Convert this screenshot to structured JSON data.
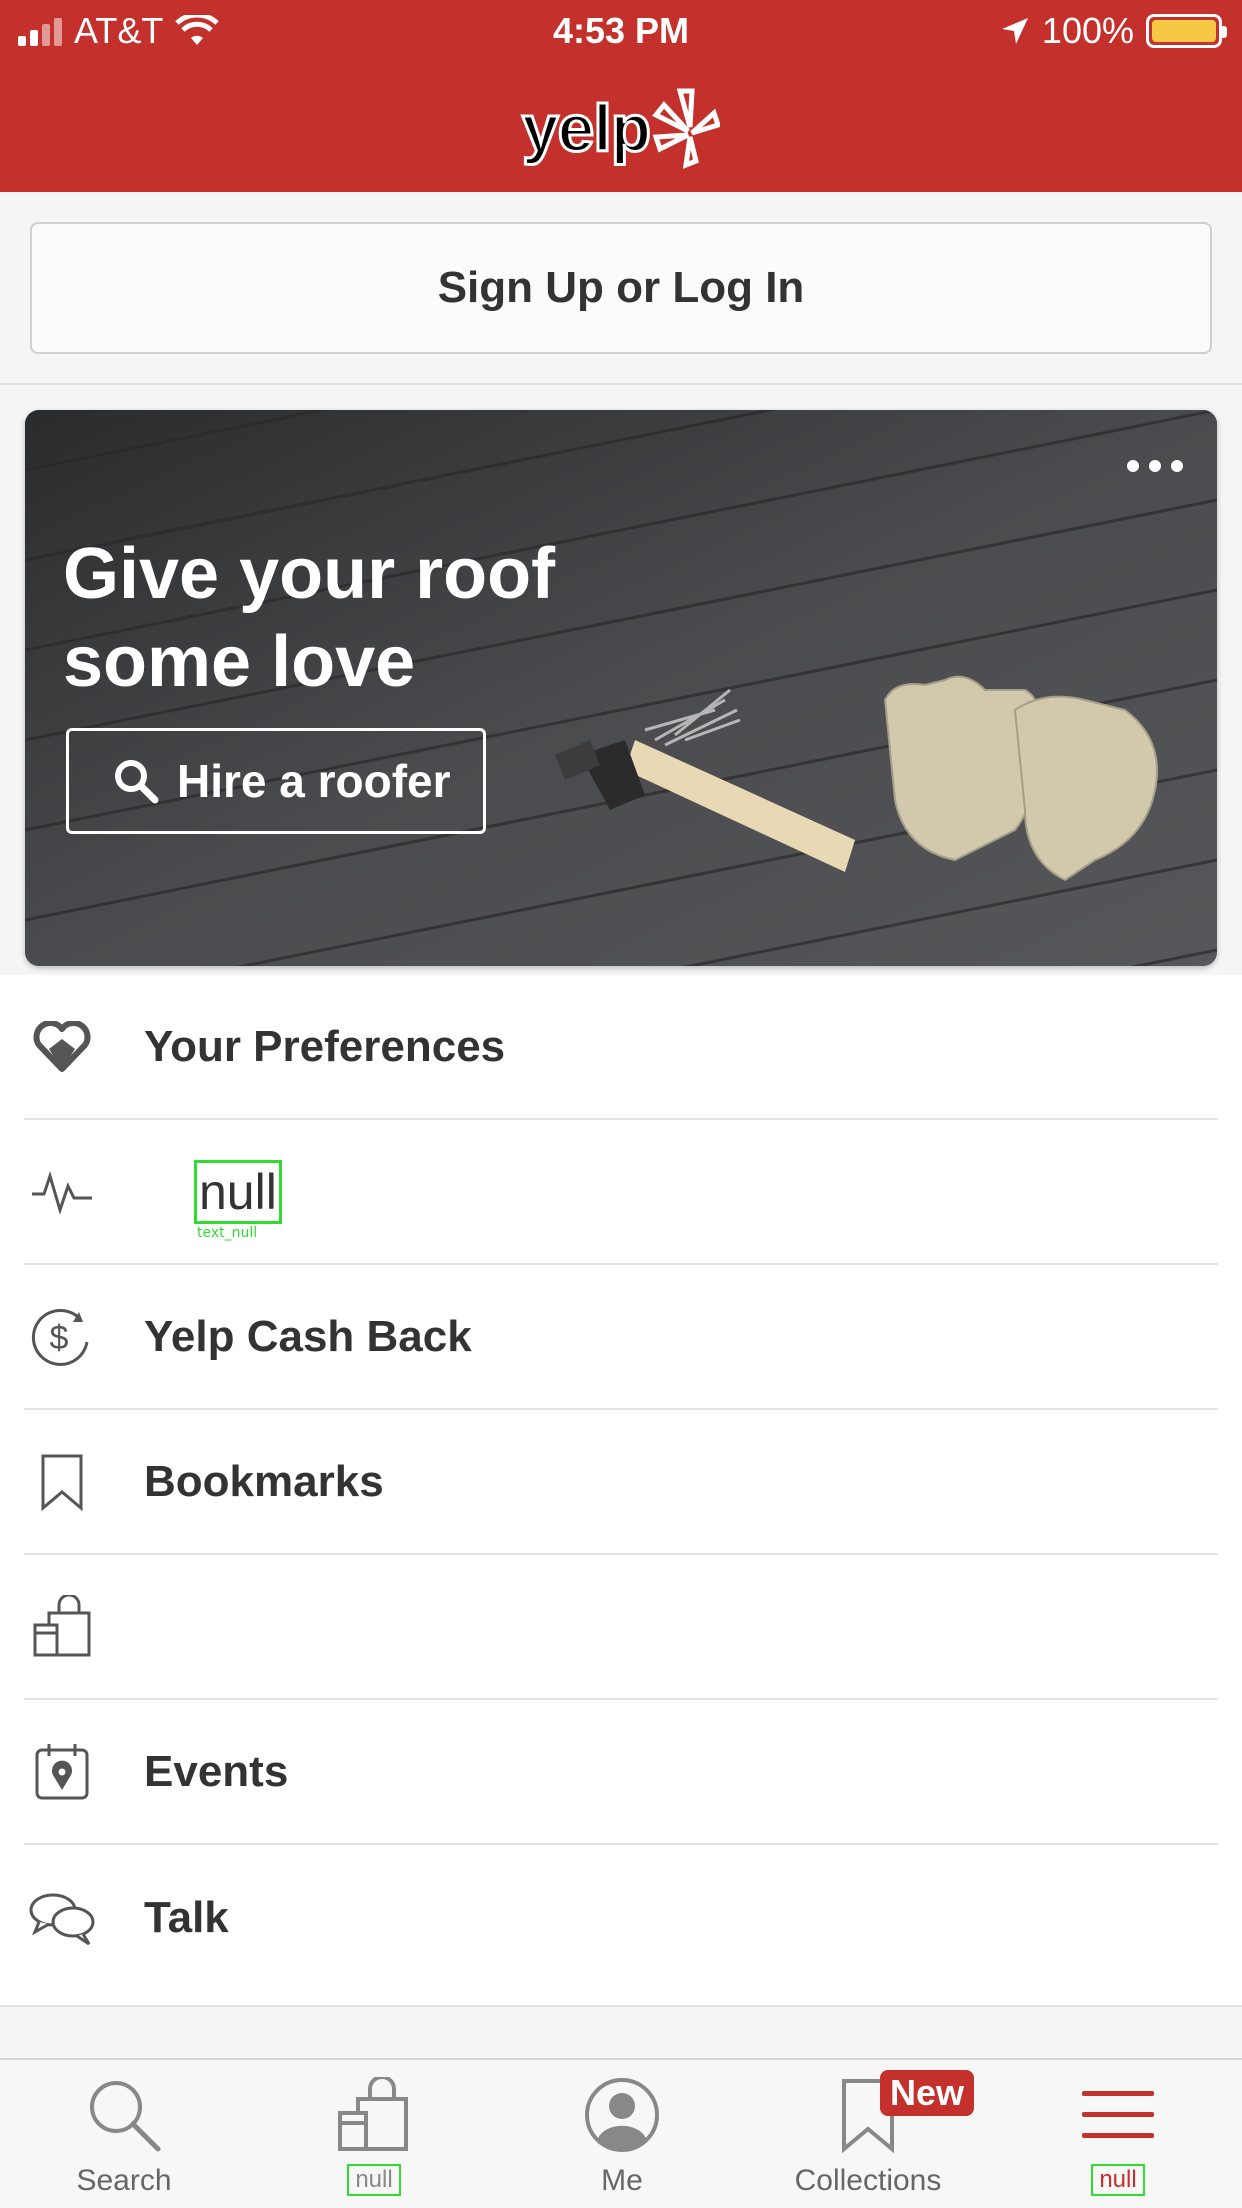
{
  "status_bar": {
    "carrier": "AT&T",
    "time": "4:53 PM",
    "battery": "100%",
    "battery_level": 1.0
  },
  "header": {
    "logo_text": "yelp",
    "brand_color": "#c4302b"
  },
  "signup": {
    "label": "Sign Up or Log In"
  },
  "banner": {
    "title": "Give your roof some love",
    "cta_label": "Hire a roofer",
    "cta_icon": "search-icon",
    "menu_icon": "more-dots-icon"
  },
  "menu": {
    "items": [
      {
        "icon": "heart-icon",
        "label": "Your Preferences"
      },
      {
        "icon": "activity-icon",
        "label": "null"
      },
      {
        "icon": "cash-back-icon",
        "label": "Yelp Cash Back"
      },
      {
        "icon": "bookmark-icon",
        "label": "Bookmarks"
      },
      {
        "icon": "shopping-bag-icon",
        "label": ""
      },
      {
        "icon": "calendar-pin-icon",
        "label": "Events"
      },
      {
        "icon": "chat-bubbles-icon",
        "label": "Talk"
      }
    ]
  },
  "tabbar": {
    "tabs": [
      {
        "icon": "search-icon",
        "label": "Search"
      },
      {
        "icon": "shopping-bag-icon",
        "label": "null"
      },
      {
        "icon": "profile-icon",
        "label": "Me"
      },
      {
        "icon": "bookmark-icon",
        "label": "Collections",
        "badge": "New"
      },
      {
        "icon": "hamburger-menu-icon",
        "label": "null"
      }
    ],
    "active_color": "#c4302b"
  }
}
